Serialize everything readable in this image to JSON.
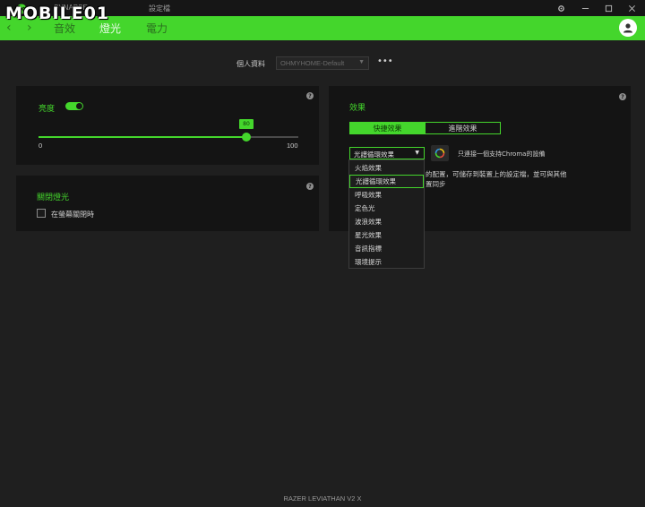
{
  "watermark": {
    "text": "MOBILE01"
  },
  "titlebar": {
    "tabs": [
      "SYNAPSE",
      "設定檔"
    ],
    "controls": [
      "gear-icon",
      "minimize-icon",
      "maximize-icon",
      "close-icon"
    ]
  },
  "nav": {
    "tabs": [
      {
        "label": "音效",
        "active": false
      },
      {
        "label": "燈光",
        "active": true
      },
      {
        "label": "電力",
        "active": false
      }
    ]
  },
  "profile": {
    "label": "個人資料",
    "selected": "OHMYHOME-Default",
    "more": "•••"
  },
  "brightness": {
    "title": "亮度",
    "enabled": true,
    "value": 80,
    "value_label": "80",
    "min_label": "0",
    "max_label": "100"
  },
  "lighting_off": {
    "title": "關閉燈光",
    "option_label": "在螢幕關閉時",
    "checked": false
  },
  "effects": {
    "title": "效果",
    "segments": [
      {
        "label": "快捷效果",
        "active": true
      },
      {
        "label": "進階效果",
        "active": false
      }
    ],
    "selected": "光譜循環效果",
    "chroma_label": "只連接一個支持Chroma的設備",
    "desc_line1": "的配置，可儲存到裝置上的設定檔，並可與其他",
    "desc_line2": "置同步",
    "options": [
      "火焰效果",
      "光譜循環效果",
      "呼吸效果",
      "定色光",
      "波浪效果",
      "星光效果",
      "音訊指標",
      "環境提示"
    ]
  },
  "footer": {
    "device": "RAZER LEVIATHAN V2 X"
  },
  "colors": {
    "accent": "#44d62c",
    "background": "#1f1f1f",
    "panel": "#141414"
  }
}
